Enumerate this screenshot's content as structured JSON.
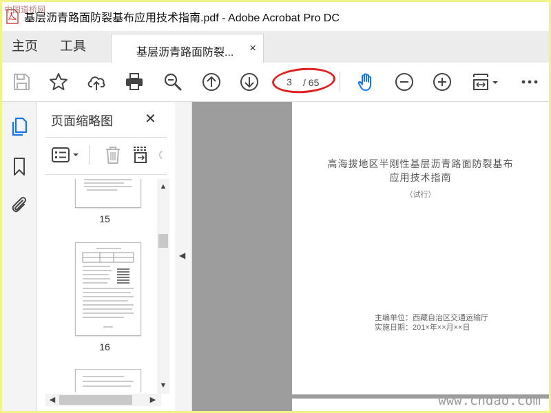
{
  "window": {
    "title": "基层沥青路面防裂基布应用技术指南.pdf - Adobe Acrobat Pro DC"
  },
  "nav_tabs": {
    "home": "主页",
    "tools": "工具"
  },
  "doc_tab": {
    "label": "基层沥青路面防裂...",
    "close": "×"
  },
  "toolbar": {
    "icons": [
      "save-icon",
      "bookmark-star-icon",
      "upload-cloud-icon",
      "print-icon",
      "zoom-search-icon",
      "page-up-icon",
      "page-down-icon",
      "hand-tool-icon",
      "zoom-out-icon",
      "zoom-in-icon",
      "fit-page-icon",
      "more-icon"
    ],
    "page_current": "3",
    "page_total": "/ 65",
    "annotation_color": "#e02020"
  },
  "left_rail": {
    "icons": [
      "pages-icon",
      "bookmark-icon",
      "attachment-icon"
    ],
    "active_color": "#1473e6"
  },
  "thumb_panel": {
    "title": "页面缩略图",
    "close": "✕",
    "thumbnails": [
      {
        "page_label": "15"
      },
      {
        "page_label": "16"
      },
      {
        "page_label": ""
      }
    ]
  },
  "document": {
    "title_line1": "高海拔地区半刚性基层沥青路面防裂基布",
    "title_line2": "应用技术指南",
    "subtitle": "（试行）",
    "editor_line": "主编单位：西藏自治区交通运输厅",
    "date_line": "实施日期：201×年××月××日"
  },
  "watermarks": {
    "top_left": "中国道桥网",
    "bottom_right": "www.cndao.com"
  },
  "colors": {
    "frame_border": "#f2f28a",
    "doc_background": "#9d9d9d",
    "accent": "#1473e6"
  }
}
